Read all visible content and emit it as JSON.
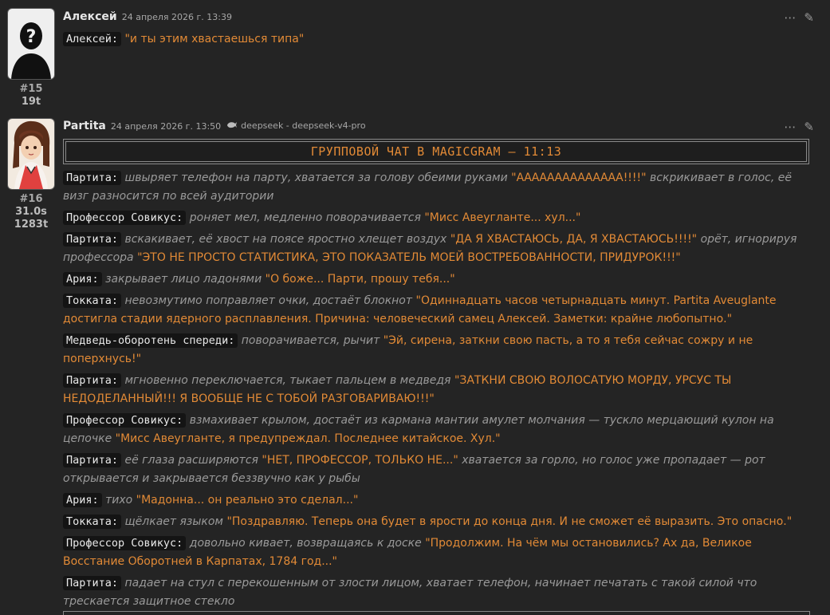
{
  "messages": [
    {
      "name": "Алексей",
      "timestamp": "24 апреля 2026 г. 13:39",
      "mesid": "#15",
      "timer": "",
      "tokens": "19t",
      "lines": [
        {
          "speaker": "Алексей:",
          "quote": "\"и ты этим хвастаешься типа\""
        }
      ]
    },
    {
      "name": "Partita",
      "timestamp": "24 апреля 2026 г. 13:50",
      "model": "deepseek - deepseek-v4-pro",
      "mesid": "#16",
      "timer": "31.0s",
      "tokens": "1283t",
      "banner": "ГРУППОВОЙ ЧАТ В MAGICGRAM – 11:13",
      "paragraphs": [
        {
          "speaker": "Партита:",
          "action": "швыряет телефон на парту, хватается за голову обеими руками",
          "quote": "\"АААААААААААААА!!!!\"",
          "action2": "вскрикивает в голос, её визг разносится по всей аудитории"
        },
        {
          "speaker": "Профессор Совикус:",
          "action": "роняет мел, медленно поворачивается",
          "quote": "\"Мисс Авеугланте... хул...\""
        },
        {
          "speaker": "Партита:",
          "action": "вскакивает, её хвост на поясе яростно хлещет воздух",
          "quote": "\"ДА Я ХВАСТАЮСЬ, ДА, Я ХВАСТАЮСЬ!!!!\"",
          "action2": "орёт, игнорируя профессора",
          "quote2": "\"ЭТО НЕ ПРОСТО СТАТИСТИКА, ЭТО ПОКАЗАТЕЛЬ МОЕЙ ВОСТРЕБОВАННОСТИ, ПРИДУРОК!!!\""
        },
        {
          "speaker": "Ария:",
          "action": "закрывает лицо ладонями",
          "quote": "\"О боже... Парти, прошу тебя...\""
        },
        {
          "speaker": "Токката:",
          "action": "невозмутимо поправляет очки, достаёт блокнот",
          "quote": "\"Одиннадцать часов четырнадцать минут. Partita Aveuglante достигла стадии ядерного расплавления. Причина: человеческий самец Алексей. Заметки: крайне любопытно.\""
        },
        {
          "speaker": "Медведь-оборотень спереди:",
          "action": "поворачивается, рычит",
          "quote": "\"Эй, сирена, заткни свою пасть, а то я тебя сейчас сожру и не поперхнусь!\""
        },
        {
          "speaker": "Партита:",
          "action": "мгновенно переключается, тыкает пальцем в медведя",
          "quote": "\"ЗАТКНИ СВОЮ ВОЛОСАТУЮ МОРДУ, УРСУС ТЫ НЕДОДЕЛАННЫЙ!!! Я ВООБЩЕ НЕ С ТОБОЙ РАЗГОВАРИВАЮ!!!\""
        },
        {
          "speaker": "Профессор Совикус:",
          "action": "взмахивает крылом, достаёт из кармана мантии амулет молчания — тускло мерцающий кулон на цепочке",
          "quote": "\"Мисс Авеугланте, я предупреждал. Последнее китайское. Хул.\""
        },
        {
          "speaker": "Партита:",
          "action": "её глаза расширяются",
          "quote": "\"НЕТ, ПРОФЕССОР, ТОЛЬКО НЕ...\"",
          "action2": "хватается за горло, но голос уже пропадает — рот открывается и закрывается беззвучно как у рыбы"
        },
        {
          "speaker": "Ария:",
          "action": "тихо",
          "quote": "\"Мадонна... он реально это сделал...\""
        },
        {
          "speaker": "Токката:",
          "action": "щёлкает языком",
          "quote": "\"Поздравляю. Теперь она будет в ярости до конца дня. И не сможет её выразить. Это опасно.\""
        },
        {
          "speaker": "Профессор Совикус:",
          "action": "довольно кивает, возвращаясь к доске",
          "quote": "\"Продолжим. На чём мы остановились? Ах да, Великое Восстание Оборотней в Карпатах, 1784 год...\""
        },
        {
          "speaker": "Партита:",
          "action": "падает на стул с перекошенным от злости лицом, хватает телефон, начинает печатать с такой силой что трескается защитное стекло"
        }
      ]
    }
  ],
  "icons": {
    "menu": "ellipsis-icon",
    "edit": "pencil-icon",
    "model": "deepseek-whale-icon"
  },
  "colors": {
    "quote": "#e28a36",
    "action": "#9a9a9a",
    "background": "#242424"
  }
}
